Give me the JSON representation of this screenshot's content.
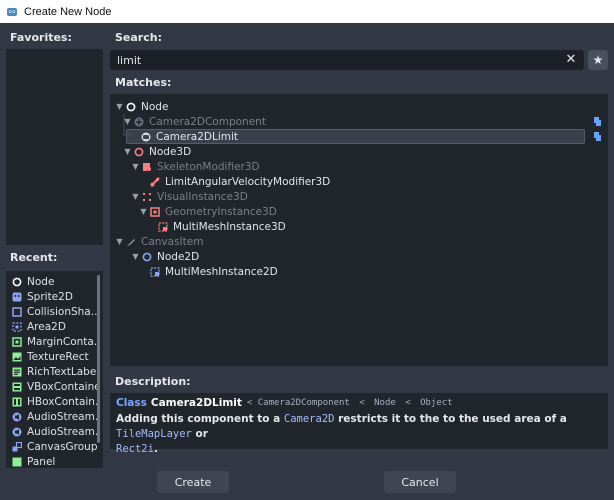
{
  "window": {
    "title": "Create New Node"
  },
  "favorites": {
    "label": "Favorites:"
  },
  "recent": {
    "label": "Recent:",
    "items": [
      {
        "label": "Node",
        "icon": "node-circle-icon"
      },
      {
        "label": "Sprite2D",
        "icon": "sprite2d-icon"
      },
      {
        "label": "CollisionSha...",
        "icon": "collision-shape-icon"
      },
      {
        "label": "Area2D",
        "icon": "area2d-icon"
      },
      {
        "label": "MarginConta...",
        "icon": "margin-container-icon"
      },
      {
        "label": "TextureRect",
        "icon": "texture-rect-icon"
      },
      {
        "label": "RichTextLabel",
        "icon": "rich-text-label-icon"
      },
      {
        "label": "VBoxContainer",
        "icon": "vbox-container-icon"
      },
      {
        "label": "HBoxContain...",
        "icon": "hbox-container-icon"
      },
      {
        "label": "AudioStream...",
        "icon": "audio-stream-icon"
      },
      {
        "label": "AudioStream...",
        "icon": "audio-stream-icon"
      },
      {
        "label": "CanvasGroup",
        "icon": "canvas-group-icon"
      },
      {
        "label": "Panel",
        "icon": "panel-icon"
      }
    ]
  },
  "search": {
    "label": "Search:",
    "value": "limit"
  },
  "matches": {
    "label": "Matches:",
    "rows": [
      {
        "label": "Node"
      },
      {
        "label": "Camera2DComponent"
      },
      {
        "label": "Camera2DLimit"
      },
      {
        "label": "Node3D"
      },
      {
        "label": "SkeletonModifier3D"
      },
      {
        "label": "LimitAngularVelocityModifier3D"
      },
      {
        "label": "VisualInstance3D"
      },
      {
        "label": "GeometryInstance3D"
      },
      {
        "label": "MultiMeshInstance3D"
      },
      {
        "label": "CanvasItem"
      },
      {
        "label": "Node2D"
      },
      {
        "label": "MultiMeshInstance2D"
      }
    ]
  },
  "description": {
    "label": "Description:",
    "class_keyword": "Class",
    "class_name": "Camera2DLimit",
    "inherits": [
      "Camera2DComponent",
      "Node",
      "Object"
    ],
    "separator": "<",
    "text_1": "Adding this component to a ",
    "link_1": "Camera2D",
    "text_2": " restricts it to the to the used area of a ",
    "link_2": "TileMapLayer",
    "text_3": " or",
    "link_3": "Rect2i",
    "text_4": "."
  },
  "buttons": {
    "create": "Create",
    "cancel": "Cancel"
  },
  "colors": {
    "node2d_blue": "#8da5f3",
    "node3d_red": "#fc7f7f",
    "control_green": "#8eef97",
    "script_blue": "#6aa3ff",
    "accent_link": "#a4bcff"
  }
}
